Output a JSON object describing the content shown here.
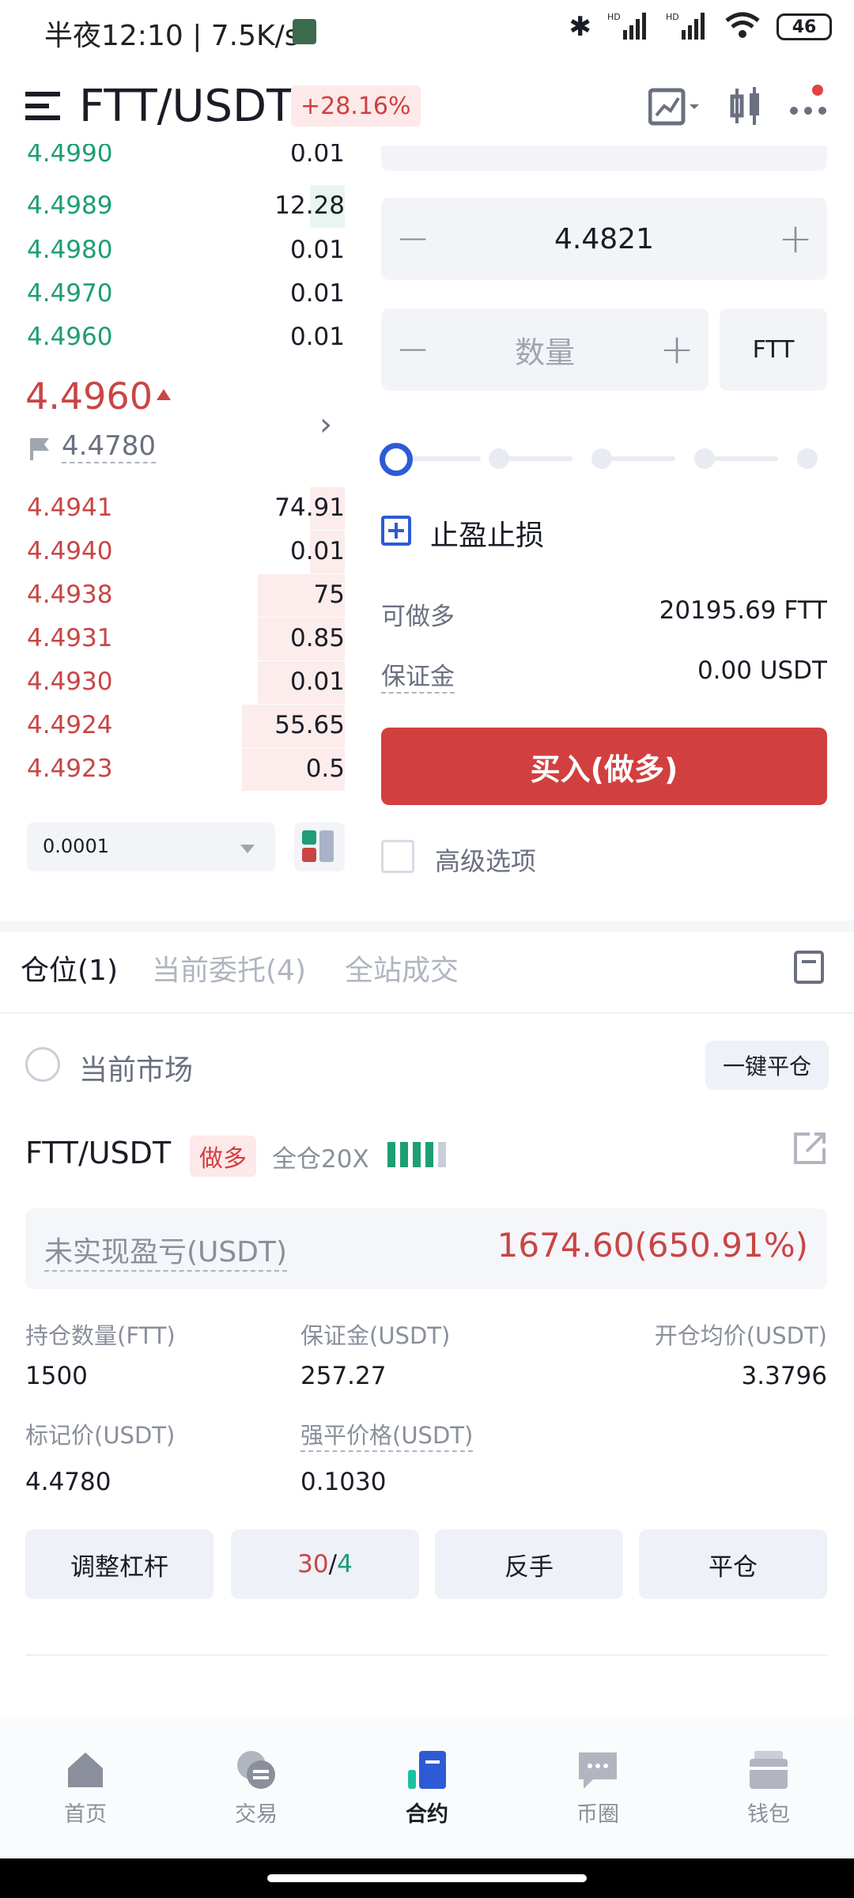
{
  "status_bar": {
    "time": "半夜12:10 | 7.5K/s",
    "battery": "46"
  },
  "header": {
    "pair": "FTT/USDT",
    "change": "+28.16%"
  },
  "order_book": {
    "asks": [
      {
        "price": "4.4990",
        "qty": "0.01",
        "depth": 0.0
      },
      {
        "price": "4.4989",
        "qty": "12.28",
        "depth": 0.1
      },
      {
        "price": "4.4980",
        "qty": "0.01",
        "depth": 0.0
      },
      {
        "price": "4.4970",
        "qty": "0.01",
        "depth": 0.0
      },
      {
        "price": "4.4960",
        "qty": "0.01",
        "depth": 0.0
      }
    ],
    "last_price": "4.4960",
    "mark_price": "4.4780",
    "bids": [
      {
        "price": "4.4941",
        "qty": "74.91",
        "depth": 0.1
      },
      {
        "price": "4.4940",
        "qty": "0.01",
        "depth": 0.1
      },
      {
        "price": "4.4938",
        "qty": "75",
        "depth": 0.25
      },
      {
        "price": "4.4931",
        "qty": "0.85",
        "depth": 0.25
      },
      {
        "price": "4.4930",
        "qty": "0.01",
        "depth": 0.25
      },
      {
        "price": "4.4924",
        "qty": "55.65",
        "depth": 0.3
      },
      {
        "price": "4.4923",
        "qty": "0.5",
        "depth": 0.3
      }
    ],
    "precision": "0.0001"
  },
  "order_form": {
    "price_value": "4.4821",
    "qty_placeholder": "数量",
    "unit": "FTT",
    "tp_sl_label": "止盈止损",
    "can_long_label": "可做多",
    "can_long_value": "20195.69 FTT",
    "margin_label": "保证金",
    "margin_value": "0.00 USDT",
    "buy_button": "买入(做多)",
    "advanced_label": "高级选项",
    "slider_percent": 0
  },
  "tabs": {
    "positions": "仓位(1)",
    "open_orders": "当前委托(4)",
    "all_trades": "全站成交"
  },
  "position_panel": {
    "current_market": "当前市场",
    "close_all": "一键平仓",
    "pair": "FTT/USDT",
    "side": "做多",
    "mode": "全仓20X",
    "unrealized_label": "未实现盈亏(USDT)",
    "unrealized_value": "1674.60(650.91%)",
    "qty_label": "持仓数量(FTT)",
    "qty_value": "1500",
    "margin_label": "保证金(USDT)",
    "margin_value": "257.27",
    "entry_label": "开仓均价(USDT)",
    "entry_value": "3.3796",
    "mark_label": "标记价(USDT)",
    "mark_value": "4.4780",
    "liq_label": "强平价格(USDT)",
    "liq_value": "0.1030",
    "btn_adjust": "调整杠杆",
    "btn_tpsl_red": "30",
    "btn_tpsl_sep": "/",
    "btn_tpsl_green": "4",
    "btn_reverse": "反手",
    "btn_close": "平仓"
  },
  "bottom_nav": [
    {
      "label": "首页",
      "icon": "home-icon"
    },
    {
      "label": "交易",
      "icon": "exchange-icon"
    },
    {
      "label": "合约",
      "icon": "contract-icon"
    },
    {
      "label": "币圈",
      "icon": "chat-icon"
    },
    {
      "label": "钱包",
      "icon": "wallet-icon"
    }
  ],
  "colors": {
    "up": "#1d9e74",
    "down": "#c94545",
    "buy_button": "#d23f3f",
    "accent_blue": "#2d5bd6"
  }
}
